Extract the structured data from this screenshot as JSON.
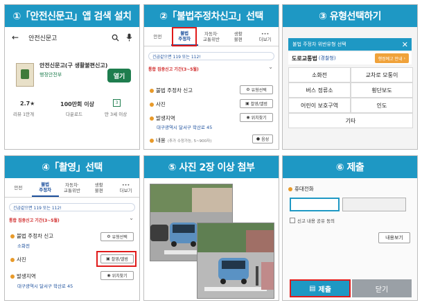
{
  "panels": {
    "p1": {
      "title": "①「안전신문고」앱 검색 설치",
      "search_text": "안전신문고",
      "app_name": "안전신문고(구 생활불편신고)",
      "developer": "행정안전부",
      "open_label": "열기",
      "rating": "2.7★",
      "rating_sub": "리뷰 1만개",
      "downloads": "100만회 이상",
      "downloads_sub": "다운로드",
      "age_sub": "만 3세 이상"
    },
    "p2": {
      "title": "②「불법주정차신고」선택",
      "tabs": [
        "안전",
        "불법\n주정차",
        "자동차·\n교통위반",
        "생활\n불편",
        "•••\n더보기"
      ],
      "notice": "긴급같으면 119 또는 112!",
      "period": "통합 집중신고 기간(3~5월)",
      "item1": "불법 주정차 신고",
      "item1_btn": "유형선택",
      "item2": "사진",
      "item2_btn": "촬영/앨범",
      "item3": "발생지역",
      "item3_btn": "위치찾기",
      "address": "대구광역시 달서구 학산로 45",
      "content_label": "내용",
      "content_hint": "(추가 수정가능, 5~900자)",
      "voice_btn": "음성"
    },
    "p3": {
      "title": "③ 유형선택하기",
      "dialog_title": "불법 주정차 위반유형 선택",
      "road_label": "도로교통법",
      "road_label_sub": "(경찰청)",
      "notice_btn": "행정예고 안내",
      "options": [
        "소화전",
        "교차로 모퉁이",
        "버스 정류소",
        "횡단보도",
        "어린이 보호구역",
        "인도",
        "기타"
      ]
    },
    "p4": {
      "title": "④「촬영」선택",
      "tabs": [
        "안전",
        "불법\n주정차",
        "자동차·\n교통위반",
        "생활\n불편",
        "•••\n더보기"
      ],
      "notice": "긴급같으면 119 또는 112!",
      "period": "통합 집중신고 기간(3~5월)",
      "item1": "불법 주정차 신고",
      "item1_sub": "소화전",
      "item1_btn": "유형선택",
      "item2": "사진",
      "item2_btn": "촬영/앨범",
      "item3": "발생지역",
      "item3_btn": "위치찾기",
      "address": "대구광역시 달서구 학산로 45"
    },
    "p5": {
      "title": "⑤ 사진 2장 이상 첨부"
    },
    "p6": {
      "title": "⑥ 제출",
      "phone_label": "휴대전화",
      "share_label": "신고 내용 공유 동의",
      "view_btn": "내용보기",
      "submit_label": "제출",
      "close_label": "닫기"
    }
  },
  "colors": {
    "header": "#1e98c4",
    "highlight": "#e01a1a",
    "link": "#1b4f9c",
    "accent_orange": "#f0a23a"
  }
}
